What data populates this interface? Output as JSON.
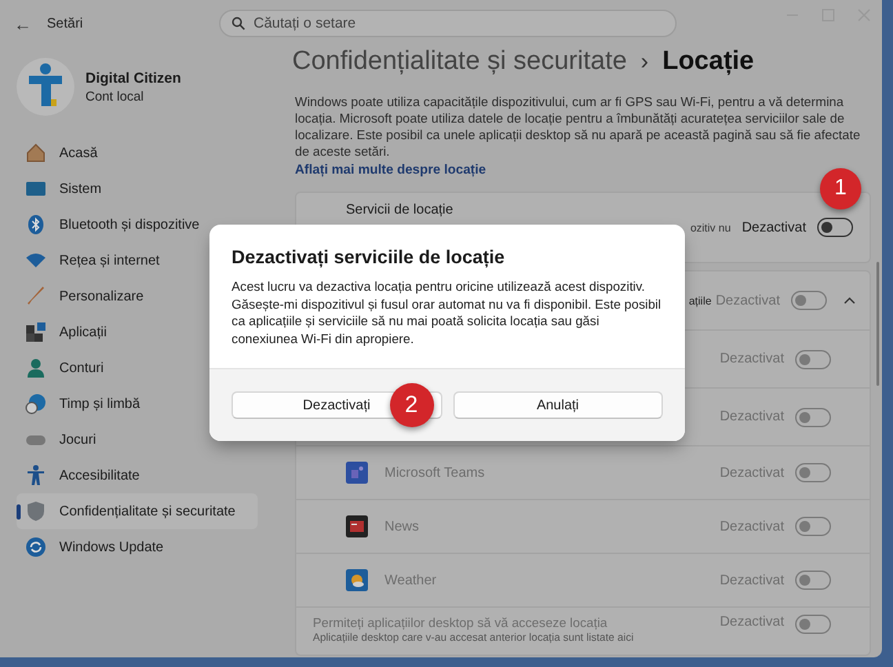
{
  "window": {
    "title": "Setări",
    "back": "←"
  },
  "search": {
    "placeholder": "Căutați o setare"
  },
  "account": {
    "name": "Digital Citizen",
    "type": "Cont local"
  },
  "nav": [
    {
      "label": "Acasă",
      "selected": false
    },
    {
      "label": "Sistem",
      "selected": false
    },
    {
      "label": "Bluetooth și dispozitive",
      "selected": false
    },
    {
      "label": "Rețea și internet",
      "selected": false
    },
    {
      "label": "Personalizare",
      "selected": false
    },
    {
      "label": "Aplicații",
      "selected": false
    },
    {
      "label": "Conturi",
      "selected": false
    },
    {
      "label": "Timp și limbă",
      "selected": false
    },
    {
      "label": "Jocuri",
      "selected": false
    },
    {
      "label": "Accesibilitate",
      "selected": false
    },
    {
      "label": "Confidențialitate și securitate",
      "selected": true
    },
    {
      "label": "Windows Update",
      "selected": false
    }
  ],
  "breadcrumb": {
    "parent": "Confidențialitate și securitate",
    "separator": "›",
    "current": "Locație"
  },
  "description": "Windows poate utiliza capacitățile dispozitivului, cum ar fi GPS sau Wi-Fi, pentru a vă determina locația. Microsoft poate utiliza datele de locație pentru a îmbunătăți acuratețea serviciilor sale de localizare. Este posibil ca unele aplicații desktop să nu apară pe această pagină sau să fie afectate de aceste setări.",
  "learn_more": "Aflați mai multe despre locație",
  "location_services": {
    "title": "Servicii de locație",
    "subtitle_fragment": "ozitiv nu",
    "status": "Dezactivat",
    "on": false,
    "disabled": false,
    "callout": "1"
  },
  "app_access": {
    "subtitle_fragment": "ațiile",
    "status": "Dezactivat",
    "on": false,
    "disabled": true,
    "expanded": true,
    "rows": [
      {
        "kind": "hidden",
        "status": "Dezactivat",
        "on": false,
        "disabled": true
      },
      {
        "kind": "hidden",
        "status": "Dezactivat",
        "on": false,
        "disabled": true
      },
      {
        "kind": "app",
        "name": "Microsoft Teams",
        "status": "Dezactivat",
        "on": false,
        "disabled": true
      },
      {
        "kind": "app",
        "name": "News",
        "status": "Dezactivat",
        "on": false,
        "disabled": true
      },
      {
        "kind": "app",
        "name": "Weather",
        "status": "Dezactivat",
        "on": false,
        "disabled": true
      },
      {
        "kind": "setting",
        "name": "Permiteți aplicațiilor desktop să vă acceseze locația",
        "subtitle": "Aplicațiile desktop care v-au accesat anterior locația sunt listate aici",
        "status": "Dezactivat",
        "on": false,
        "disabled": true
      }
    ]
  },
  "dialog": {
    "title": "Dezactivați serviciile de locație",
    "body": "Acest lucru va dezactiva locația pentru oricine utilizează acest dispozitiv.\nGăsește-mi dispozitivul și fusul orar automat nu va fi disponibil. Este posibil ca aplicațiile și serviciile să nu mai poată solicita locația sau găsi conexiunea Wi-Fi din apropiere.",
    "buttons": [
      {
        "label": "Dezactivați",
        "callout": "2"
      },
      {
        "label": "Anulați"
      }
    ]
  }
}
